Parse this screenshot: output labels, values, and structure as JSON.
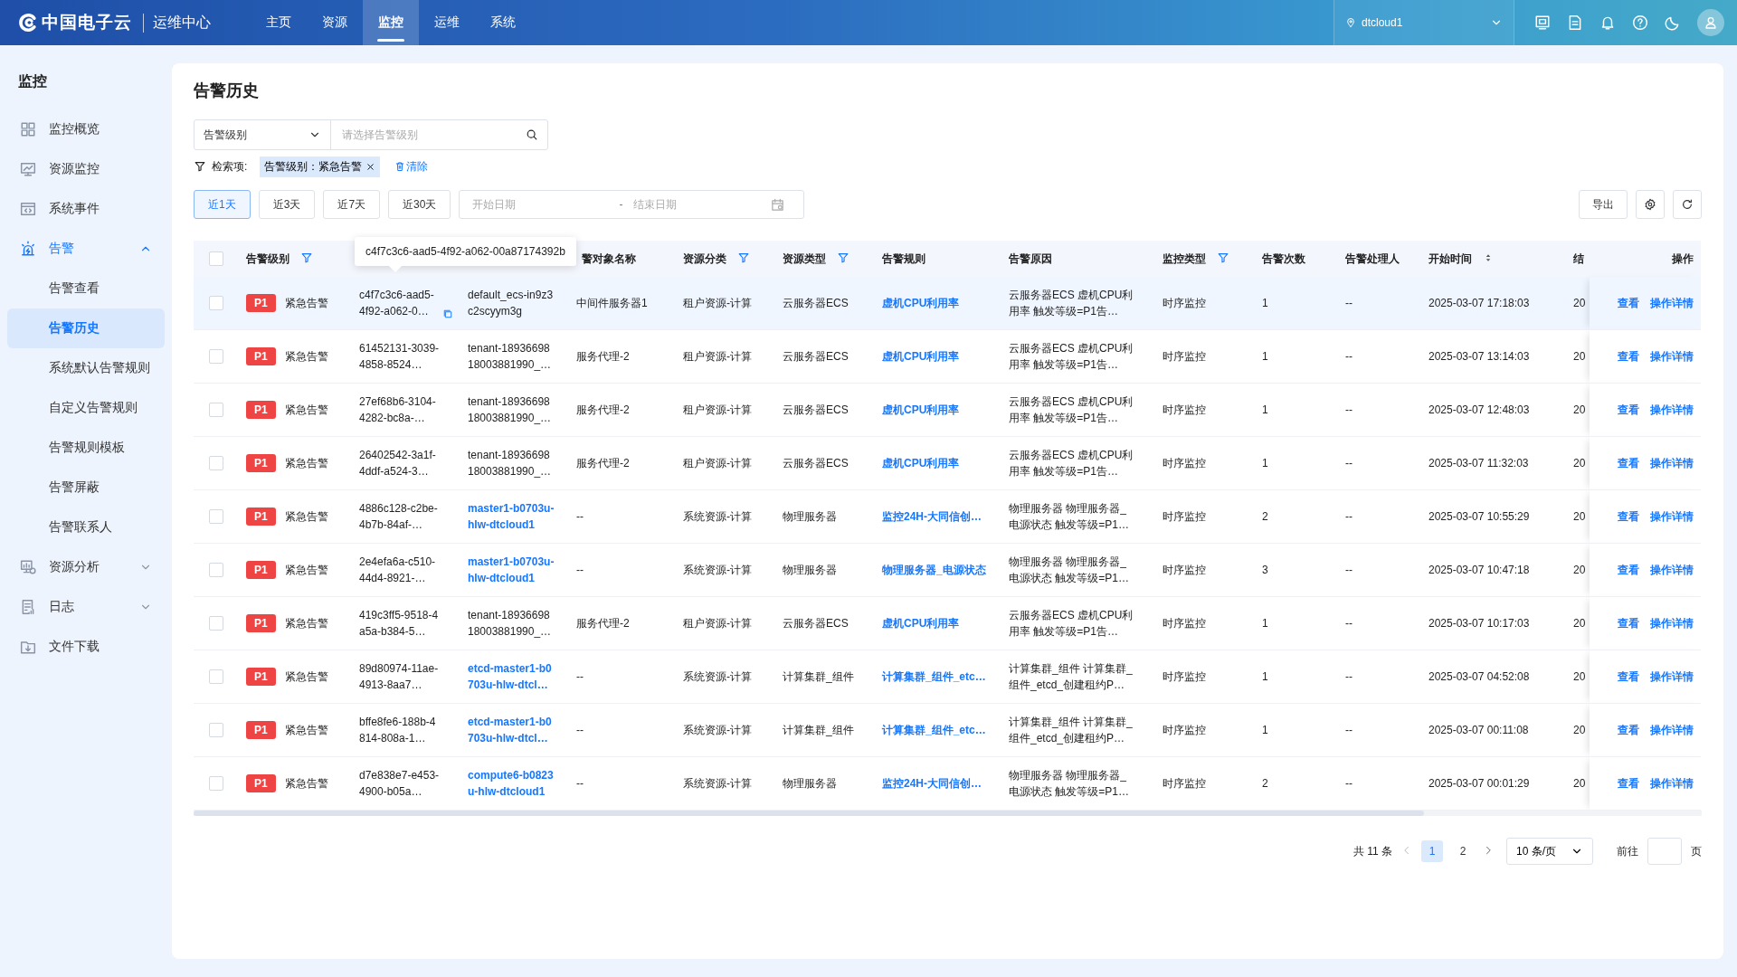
{
  "header": {
    "logo": "中国电子云",
    "app": "运维中心",
    "nav": [
      {
        "label": "主页",
        "selected": false
      },
      {
        "label": "资源",
        "selected": false
      },
      {
        "label": "监控",
        "selected": true
      },
      {
        "label": "运维",
        "selected": false
      },
      {
        "label": "系统",
        "selected": false
      }
    ],
    "region": "dtcloud1"
  },
  "sidebar": {
    "title": "监控",
    "items": [
      {
        "label": "监控概览",
        "selected": false
      },
      {
        "label": "资源监控",
        "selected": false
      },
      {
        "label": "系统事件",
        "selected": false
      },
      {
        "label": "告警",
        "selected": false,
        "expanded": true,
        "children": [
          {
            "label": "告警查看",
            "selected": false
          },
          {
            "label": "告警历史",
            "selected": true
          },
          {
            "label": "系统默认告警规则",
            "selected": false
          },
          {
            "label": "自定义告警规则",
            "selected": false
          },
          {
            "label": "告警规则模板",
            "selected": false
          },
          {
            "label": "告警屏蔽",
            "selected": false
          },
          {
            "label": "告警联系人",
            "selected": false
          }
        ]
      },
      {
        "label": "资源分析",
        "selected": false,
        "expanded": false
      },
      {
        "label": "日志",
        "selected": false,
        "expanded": false
      },
      {
        "label": "文件下载",
        "selected": false
      }
    ]
  },
  "page": {
    "title": "告警历史",
    "filter": {
      "select": "告警级别",
      "placeholder": "请选择告警级别"
    },
    "criteria": {
      "label": "检索项:",
      "tag": "告警级别：紧急告警",
      "clear": "清除"
    },
    "ranges": [
      {
        "label": "近1天",
        "selected": true
      },
      {
        "label": "近3天",
        "selected": false
      },
      {
        "label": "近7天",
        "selected": false
      },
      {
        "label": "近30天",
        "selected": false
      }
    ],
    "date": {
      "start_placeholder": "开始日期",
      "separator": "-",
      "end_placeholder": "结束日期"
    },
    "export": "导出"
  },
  "table": {
    "select_all_checked": false,
    "tooltip": "c4f7c3c6-aad5-4f92-a062-00a87174392b",
    "columns": [
      {
        "kind": "header",
        "label": "告警级别",
        "filter": true
      },
      {
        "kind": "covered"
      },
      {
        "kind": "covered"
      },
      {
        "kind": "header",
        "label": "警对象名称"
      },
      {
        "kind": "header",
        "label": "资源分类",
        "filter": true
      },
      {
        "kind": "header",
        "label": "资源类型",
        "filter": true
      },
      {
        "kind": "header",
        "label": "告警规则"
      },
      {
        "kind": "header",
        "label": "告警原因"
      },
      {
        "kind": "header",
        "label": "监控类型",
        "filter": true
      },
      {
        "kind": "header",
        "label": "告警次数"
      },
      {
        "kind": "header",
        "label": "告警处理人"
      },
      {
        "kind": "header",
        "label": "开始时间",
        "sort": true
      },
      {
        "kind": "header",
        "label": "结"
      },
      {
        "kind": "header",
        "label": "操作"
      }
    ],
    "rows": [
      {
        "checked": false,
        "highlighted": true,
        "priority": "P1",
        "level": "紧急告警",
        "id": "c4f7c3c6-aad5-4f92-a062-0…",
        "object": "default_ecs-in9z3c2scyym3g",
        "object_link": false,
        "object_name": "中间件服务器1",
        "category": "租户资源-计算",
        "type": "云服务器ECS",
        "rule": "虚机CPU利用率",
        "reason": "云服务器ECS 虚机CPU利用率 触发等级=P1告…",
        "monitor": "时序监控",
        "count": "1",
        "handler": "--",
        "start": "2025-03-07 17:18:03",
        "end": "20",
        "actions": [
          "查看",
          "操作详情"
        ]
      },
      {
        "checked": false,
        "highlighted": false,
        "priority": "P1",
        "level": "紧急告警",
        "id": "61452131-3039-4858-8524…",
        "object": "tenant-1893669818003881990_…",
        "object_link": false,
        "object_name": "服务代理-2",
        "category": "租户资源-计算",
        "type": "云服务器ECS",
        "rule": "虚机CPU利用率",
        "reason": "云服务器ECS 虚机CPU利用率 触发等级=P1告…",
        "monitor": "时序监控",
        "count": "1",
        "handler": "--",
        "start": "2025-03-07 13:14:03",
        "end": "20",
        "actions": [
          "查看",
          "操作详情"
        ]
      },
      {
        "checked": false,
        "highlighted": false,
        "priority": "P1",
        "level": "紧急告警",
        "id": "27ef68b6-3104-4282-bc8a-…",
        "object": "tenant-1893669818003881990_…",
        "object_link": false,
        "object_name": "服务代理-2",
        "category": "租户资源-计算",
        "type": "云服务器ECS",
        "rule": "虚机CPU利用率",
        "reason": "云服务器ECS 虚机CPU利用率 触发等级=P1告…",
        "monitor": "时序监控",
        "count": "1",
        "handler": "--",
        "start": "2025-03-07 12:48:03",
        "end": "20",
        "actions": [
          "查看",
          "操作详情"
        ]
      },
      {
        "checked": false,
        "highlighted": false,
        "priority": "P1",
        "level": "紧急告警",
        "id": "26402542-3a1f-4ddf-a524-3…",
        "object": "tenant-1893669818003881990_…",
        "object_link": false,
        "object_name": "服务代理-2",
        "category": "租户资源-计算",
        "type": "云服务器ECS",
        "rule": "虚机CPU利用率",
        "reason": "云服务器ECS 虚机CPU利用率 触发等级=P1告…",
        "monitor": "时序监控",
        "count": "1",
        "handler": "--",
        "start": "2025-03-07 11:32:03",
        "end": "20",
        "actions": [
          "查看",
          "操作详情"
        ]
      },
      {
        "checked": false,
        "highlighted": false,
        "priority": "P1",
        "level": "紧急告警",
        "id": "4886c128-c2be-4b7b-84af-…",
        "object": "master1-b0703u-hlw-dtcloud1",
        "object_link": true,
        "object_name": "--",
        "category": "系统资源-计算",
        "type": "物理服务器",
        "rule": "监控24H-大同信创…",
        "reason": "物理服务器 物理服务器_电源状态 触发等级=P1…",
        "monitor": "时序监控",
        "count": "2",
        "handler": "--",
        "start": "2025-03-07 10:55:29",
        "end": "20",
        "actions": [
          "查看",
          "操作详情"
        ]
      },
      {
        "checked": false,
        "highlighted": false,
        "priority": "P1",
        "level": "紧急告警",
        "id": "2e4efa6a-c510-44d4-8921-…",
        "object": "master1-b0703u-hlw-dtcloud1",
        "object_link": true,
        "object_name": "--",
        "category": "系统资源-计算",
        "type": "物理服务器",
        "rule": "物理服务器_电源状态",
        "reason": "物理服务器 物理服务器_电源状态 触发等级=P1…",
        "monitor": "时序监控",
        "count": "3",
        "handler": "--",
        "start": "2025-03-07 10:47:18",
        "end": "20",
        "actions": [
          "查看",
          "操作详情"
        ]
      },
      {
        "checked": false,
        "highlighted": false,
        "priority": "P1",
        "level": "紧急告警",
        "id": "419c3ff5-9518-4a5a-b384-5…",
        "object": "tenant-1893669818003881990_…",
        "object_link": false,
        "object_name": "服务代理-2",
        "category": "租户资源-计算",
        "type": "云服务器ECS",
        "rule": "虚机CPU利用率",
        "reason": "云服务器ECS 虚机CPU利用率 触发等级=P1告…",
        "monitor": "时序监控",
        "count": "1",
        "handler": "--",
        "start": "2025-03-07 10:17:03",
        "end": "20",
        "actions": [
          "查看",
          "操作详情"
        ]
      },
      {
        "checked": false,
        "highlighted": false,
        "priority": "P1",
        "level": "紧急告警",
        "id": "89d80974-11ae-4913-8aa7…",
        "object": "etcd-master1-b0703u-hlw-dtcl…",
        "object_link": true,
        "object_name": "--",
        "category": "系统资源-计算",
        "type": "计算集群_组件",
        "rule": "计算集群_组件_etc…",
        "reason": "计算集群_组件 计算集群_组件_etcd_创建租约P…",
        "monitor": "时序监控",
        "count": "1",
        "handler": "--",
        "start": "2025-03-07 04:52:08",
        "end": "20",
        "actions": [
          "查看",
          "操作详情"
        ]
      },
      {
        "checked": false,
        "highlighted": false,
        "priority": "P1",
        "level": "紧急告警",
        "id": "bffe8fe6-188b-4814-808a-1…",
        "object": "etcd-master1-b0703u-hlw-dtcl…",
        "object_link": true,
        "object_name": "--",
        "category": "系统资源-计算",
        "type": "计算集群_组件",
        "rule": "计算集群_组件_etc…",
        "reason": "计算集群_组件 计算集群_组件_etcd_创建租约P…",
        "monitor": "时序监控",
        "count": "1",
        "handler": "--",
        "start": "2025-03-07 00:11:08",
        "end": "20",
        "actions": [
          "查看",
          "操作详情"
        ]
      },
      {
        "checked": false,
        "highlighted": false,
        "priority": "P1",
        "level": "紧急告警",
        "id": "d7e838e7-e453-4900-b05a…",
        "object": "compute6-b0823u-hlw-dtcloud1",
        "object_link": true,
        "object_name": "--",
        "category": "系统资源-计算",
        "type": "物理服务器",
        "rule": "监控24H-大同信创…",
        "reason": "物理服务器 物理服务器_电源状态 触发等级=P1…",
        "monitor": "时序监控",
        "count": "2",
        "handler": "--",
        "start": "2025-03-07 00:01:29",
        "end": "20",
        "actions": [
          "查看",
          "操作详情"
        ]
      }
    ]
  },
  "pagination": {
    "total": "共 11 条",
    "pages": [
      {
        "label": "1",
        "selected": true
      },
      {
        "label": "2",
        "selected": false
      }
    ],
    "page_size": "10 条/页",
    "goto": "前往",
    "goto_suffix": "页"
  }
}
